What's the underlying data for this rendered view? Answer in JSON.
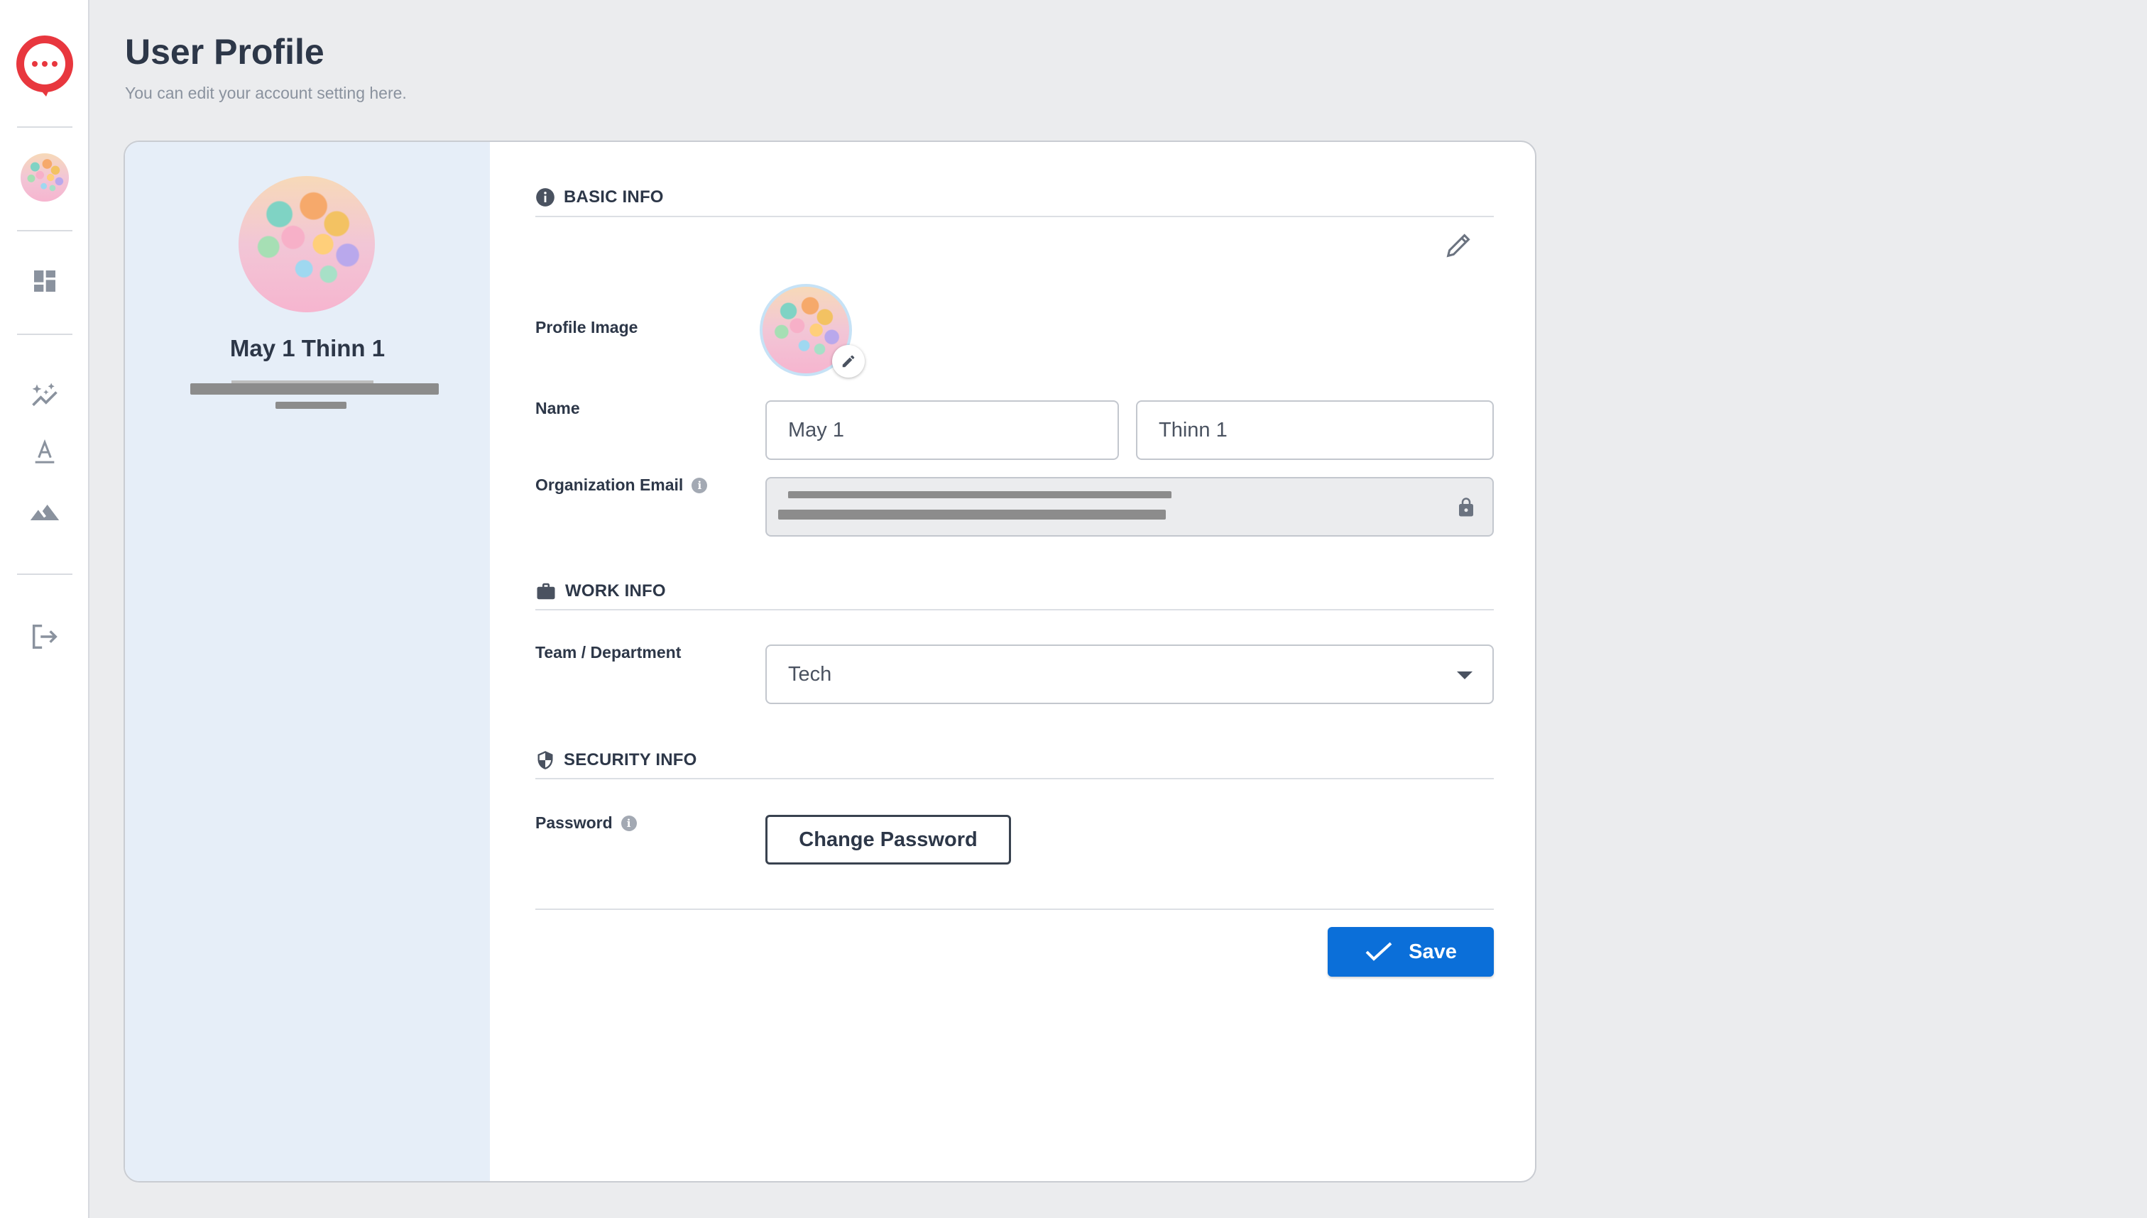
{
  "header": {
    "title": "User Profile",
    "subtitle": "You can edit your account setting here."
  },
  "sidebar": {
    "items": [
      {
        "icon": "chat-logo-icon"
      },
      {
        "icon": "user-avatar"
      },
      {
        "icon": "dashboard-icon"
      },
      {
        "icon": "sparkle-chart-icon"
      },
      {
        "icon": "text-format-icon"
      },
      {
        "icon": "landscape-icon"
      },
      {
        "icon": "logout-icon"
      }
    ]
  },
  "profile_card": {
    "name": "May 1 Thinn 1"
  },
  "basic_info": {
    "heading": "BASIC INFO",
    "profile_image_label": "Profile Image",
    "name_label": "Name",
    "first_name": "May 1",
    "last_name": "Thinn 1",
    "email_label": "Organization Email"
  },
  "work_info": {
    "heading": "WORK INFO",
    "team_label": "Team / Department",
    "team_value": "Tech"
  },
  "security_info": {
    "heading": "SECURITY INFO",
    "password_label": "Password",
    "change_password_label": "Change Password"
  },
  "actions": {
    "save_label": "Save"
  },
  "colors": {
    "accent": "#0b6fd9",
    "brand": "#e8373e",
    "profile_panel": "#e6eef8"
  }
}
